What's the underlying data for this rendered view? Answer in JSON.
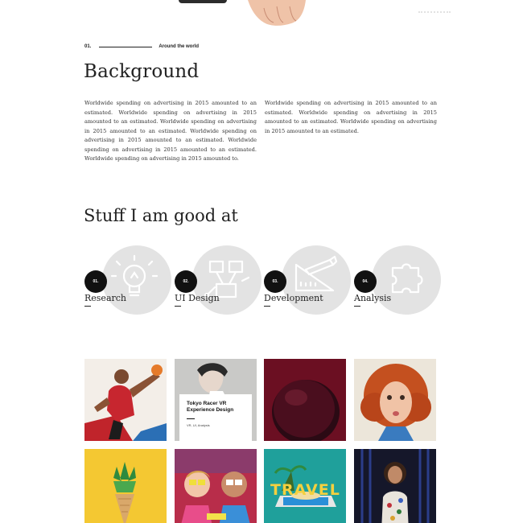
{
  "section": {
    "number": "01.",
    "label": "Around the world"
  },
  "background": {
    "heading": "Background",
    "left_paragraph": "Worldwide spending on advertising in 2015 amounted to an estimated. Worldwide spending on advertising in 2015 amounted to an estimated. Worldwide spending on advertising in 2015 amounted to an estimated. Worldwide spending on advertising in 2015 amounted to an estimated. Worldwide spending on advertising in 2015 amounted to an estimated. Worldwide spending on advertising in 2015 amounted to.",
    "right_paragraph": "Worldwide spending on advertising in 2015 amounted to an estimated. Worldwide spending on advertising in 2015 amounted to an estimated. Worldwide spending on advertising in 2015 amounted to an estimated."
  },
  "skills": {
    "heading": "Stuff I am good at",
    "items": [
      {
        "number": "01.",
        "name": "Research",
        "icon": "lightbulb-icon"
      },
      {
        "number": "02.",
        "name": "UI Design",
        "icon": "wireframe-icon"
      },
      {
        "number": "03.",
        "name": "Development",
        "icon": "ruler-pencil-icon"
      },
      {
        "number": "04.",
        "name": "Analysis",
        "icon": "puzzle-icon"
      }
    ]
  },
  "portfolio": {
    "featured_card": {
      "title": "Tokyo Racer VR Experience Design",
      "tags": "VR, UI, Analysis"
    },
    "tiles": [
      {
        "subject": "basketball-player"
      },
      {
        "subject": "vr-headset-woman"
      },
      {
        "subject": "peach-on-red"
      },
      {
        "subject": "redhead-woman"
      },
      {
        "subject": "pineapple-cone"
      },
      {
        "subject": "kids-with-glasses"
      },
      {
        "subject": "travel-phone",
        "text": "TRAVEL"
      },
      {
        "subject": "woman-on-stage"
      }
    ]
  },
  "colors": {
    "text": "#222222",
    "circle": "#e3e3e3",
    "badge": "#111111"
  }
}
